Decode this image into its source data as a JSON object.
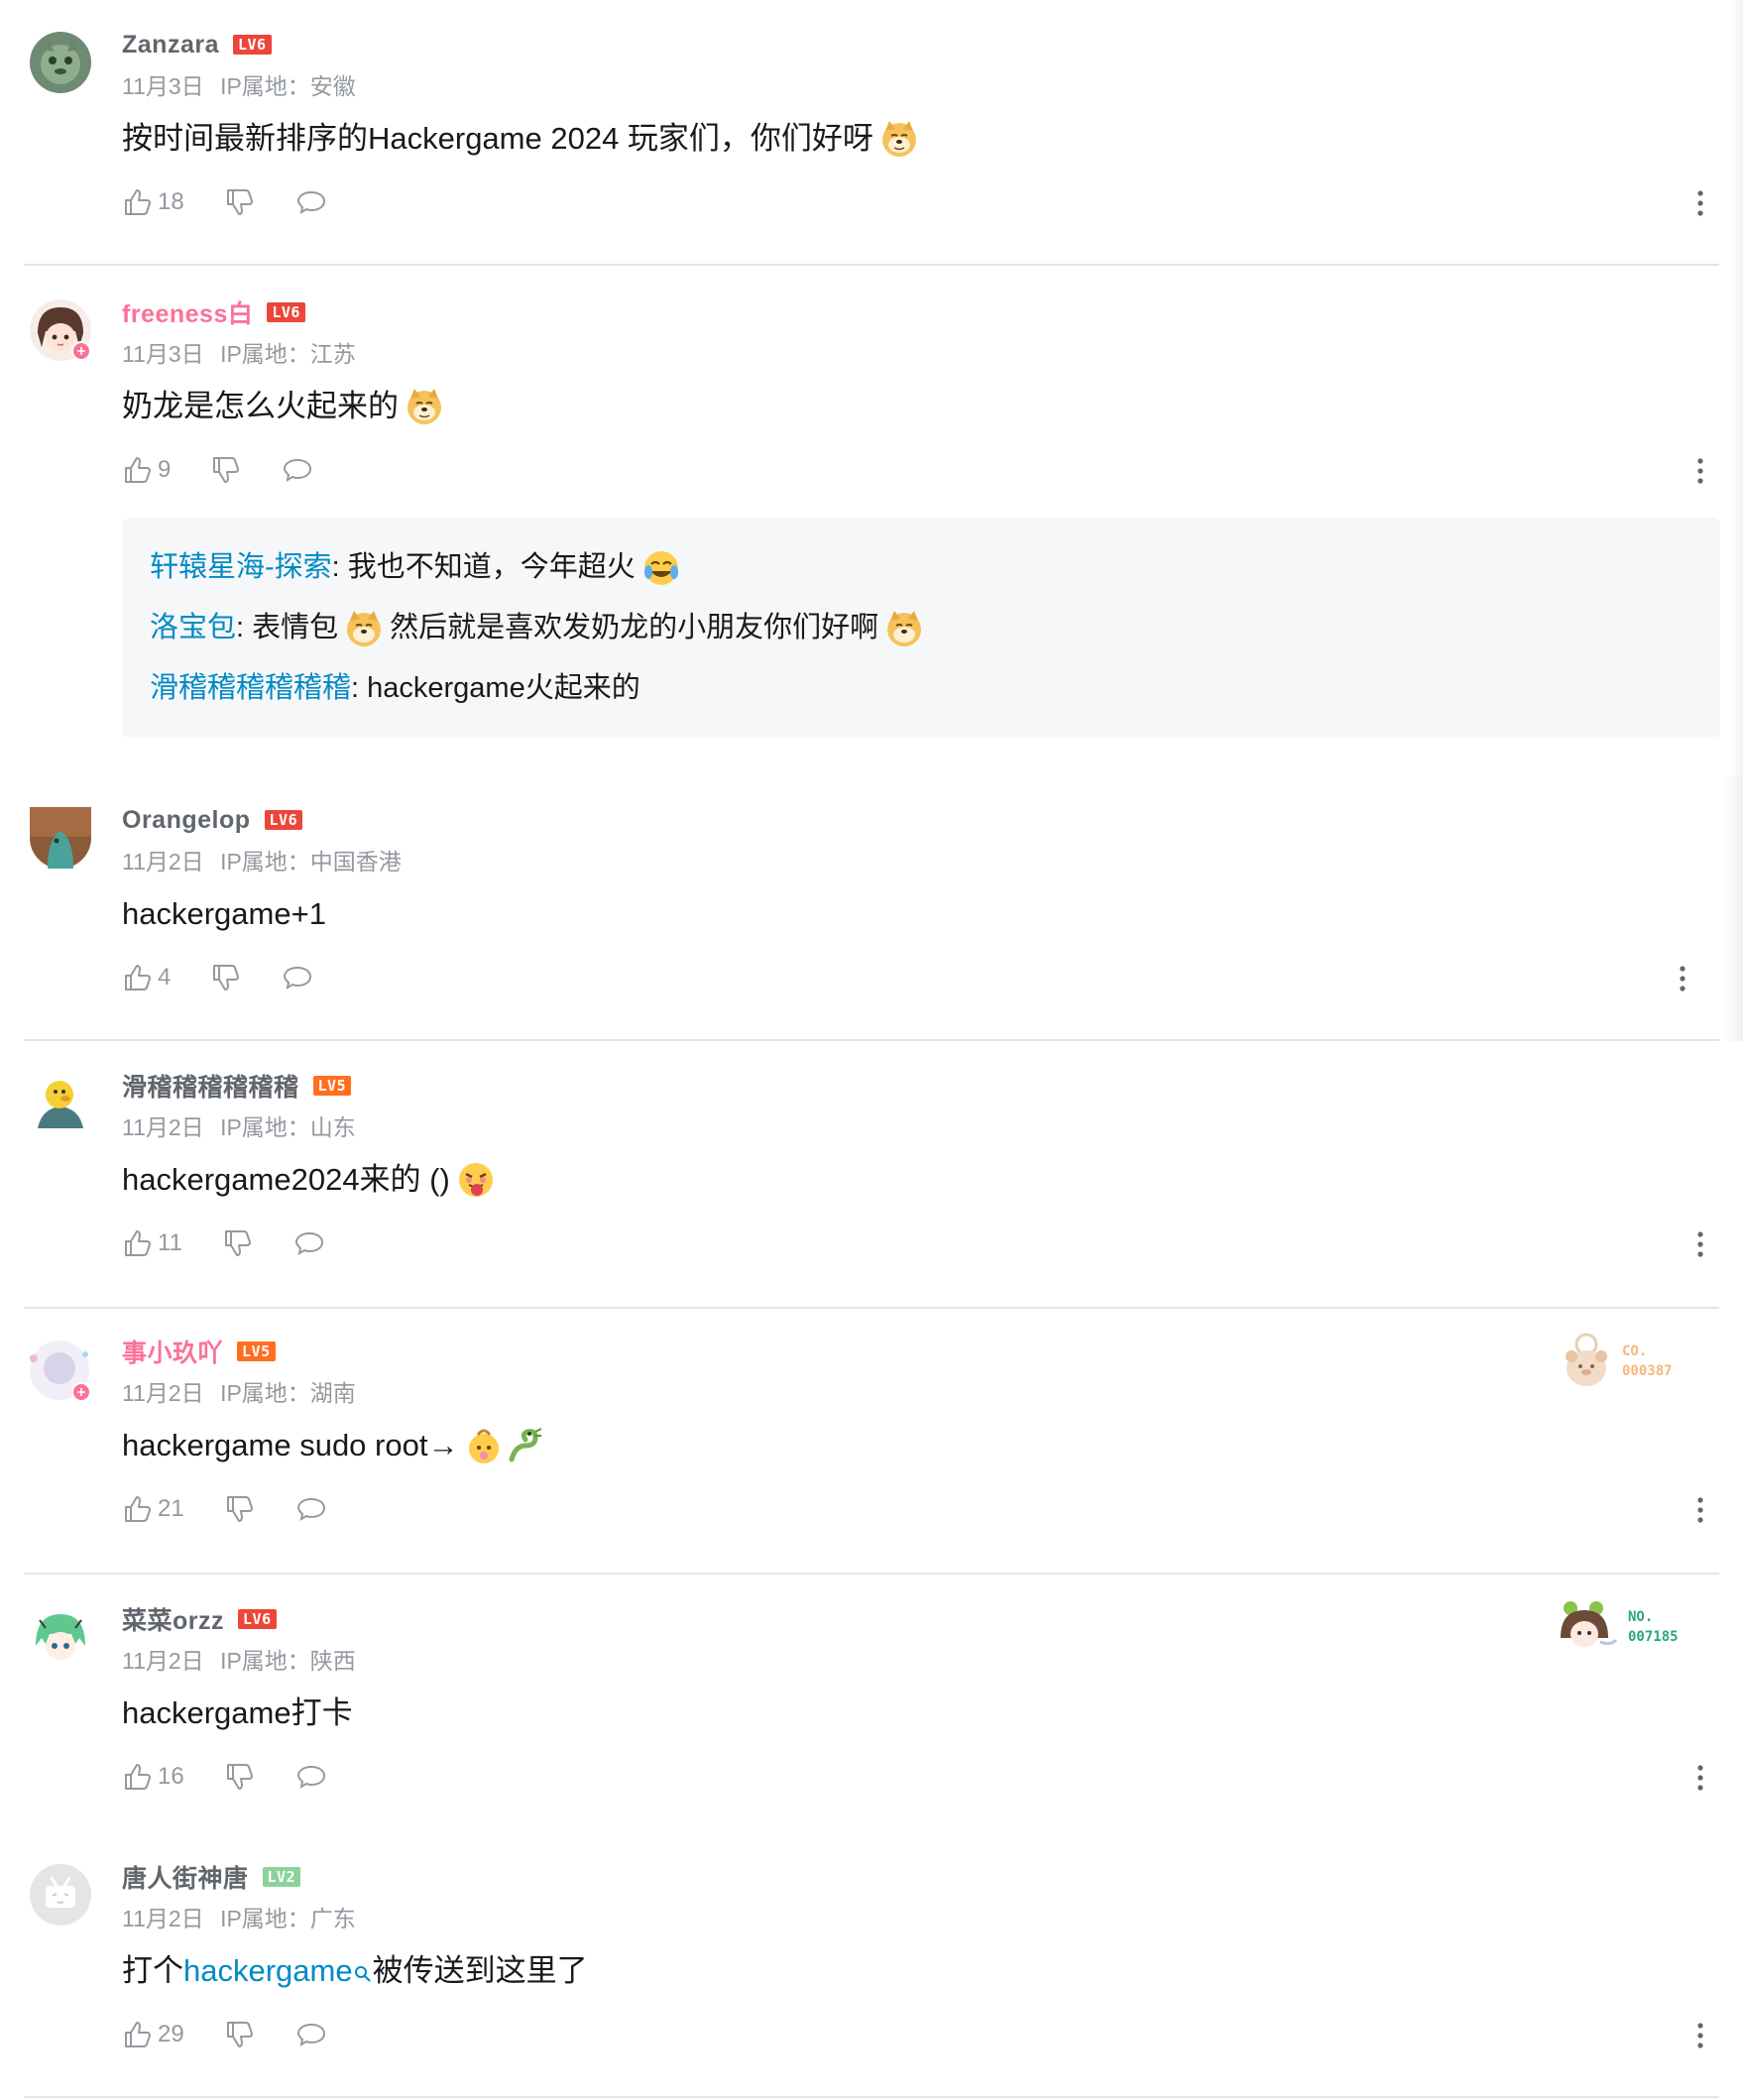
{
  "comments": [
    {
      "user": "Zanzara",
      "level": "LV6",
      "date": "11月3日",
      "ip": "IP属地：安徽",
      "text": "按时间最新排序的Hackergame 2024 玩家们，你们好呀",
      "emoji": "doge-emoji",
      "likes": "18"
    },
    {
      "user": "freeness白",
      "level": "LV6",
      "date": "11月3日",
      "ip": "IP属地：江苏",
      "text": "奶龙是怎么火起来的",
      "emoji": "doge-emoji",
      "likes": "9",
      "replies": [
        {
          "name": "轩辕星海-探索",
          "text": ": 我也不知道，今年超火"
        },
        {
          "name": "洛宝包",
          "text": ": 表情包",
          "text2": "然后就是喜欢发奶龙的小朋友你们好啊"
        },
        {
          "name": "滑稽稽稽稽稽稽",
          "text": ": hackergame火起来的"
        }
      ]
    },
    {
      "user": "Orangelop",
      "level": "LV6",
      "date": "11月2日",
      "ip": "IP属地：中国香港",
      "text": "hackergame+1",
      "likes": "4"
    },
    {
      "user": "滑稽稽稽稽稽稽",
      "level": "LV5",
      "date": "11月2日",
      "ip": "IP属地：山东",
      "text": "hackergame2024来的 ()",
      "emoji": "tongue-emoji",
      "likes": "11"
    },
    {
      "user": "事小玖吖",
      "level": "LV5",
      "date": "11月2日",
      "ip": "IP属地：湖南",
      "text": "hackergame sudo root→",
      "emoji": "baby-emoji",
      "likes": "21",
      "badge": {
        "line1": "CO.",
        "line2": "000387"
      }
    },
    {
      "user": "菜菜orzz",
      "level": "LV6",
      "date": "11月2日",
      "ip": "IP属地：陕西",
      "text": "hackergame打卡",
      "likes": "16",
      "badge": {
        "line1": "NO.",
        "line2": "007185"
      }
    },
    {
      "user": "唐人街神唐",
      "level": "LV2",
      "date": "11月2日",
      "ip": "IP属地：广东",
      "text_pre": "打个",
      "text_link": "hackergame",
      "text_post": "被传送到这里了",
      "likes": "29"
    }
  ],
  "colors": {
    "username": "#61666d",
    "vip_username": "#fb7299",
    "link": "#008ac5",
    "meta": "#9499a0",
    "lv6": "#ee453a",
    "lv5": "#ff6f1f",
    "lv2": "#8bd29b"
  }
}
